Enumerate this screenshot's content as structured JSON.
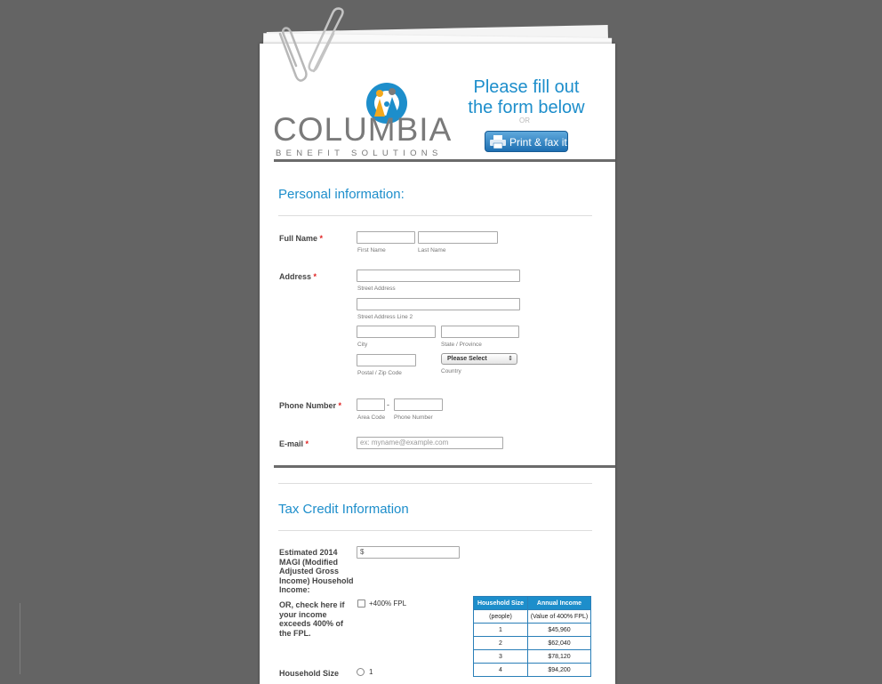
{
  "header": {
    "logo_main": "COLUMBIA",
    "logo_sub": "BENEFIT SOLUTIONS",
    "cta_line1": "Please fill out",
    "cta_line2": "the form below",
    "or_text": "OR",
    "print_button": "Print & fax it"
  },
  "personal": {
    "title": "Personal information:",
    "full_name_label": "Full Name",
    "first_name_sub": "First Name",
    "last_name_sub": "Last Name",
    "address_label": "Address",
    "street_sub": "Street Address",
    "street2_sub": "Street Address Line 2",
    "city_sub": "City",
    "state_sub": "State / Province",
    "postal_sub": "Postal / Zip Code",
    "country_value": "Please Select",
    "country_sub": "Country",
    "phone_label": "Phone Number",
    "phone_dash": "-",
    "area_sub": "Area Code",
    "phone_sub": "Phone Number",
    "email_label": "E-mail",
    "email_placeholder": "ex: myname@example.com",
    "required_mark": "*"
  },
  "tax": {
    "title": "Tax Credit Information",
    "magi_label": "Estimated 2014 MAGI (Modified Adjusted Gross Income) Household Income:",
    "magi_value": "$",
    "exceed_label": "OR, check here if your income exceeds 400% of the FPL.",
    "exceed_option": "+400% FPL",
    "household_label": "Household Size",
    "household_option_1": "1",
    "table": {
      "header_size": "Household Size",
      "header_income": "Annual Income",
      "sub_size": "(people)",
      "sub_income": "(Value of 400% FPL)",
      "rows": [
        {
          "size": "1",
          "income": "$45,960"
        },
        {
          "size": "2",
          "income": "$62,040"
        },
        {
          "size": "3",
          "income": "$78,120"
        },
        {
          "size": "4",
          "income": "$94,200"
        }
      ]
    }
  },
  "colors": {
    "accent": "#1d8ecb",
    "background": "#646464",
    "required": "#e02020"
  }
}
